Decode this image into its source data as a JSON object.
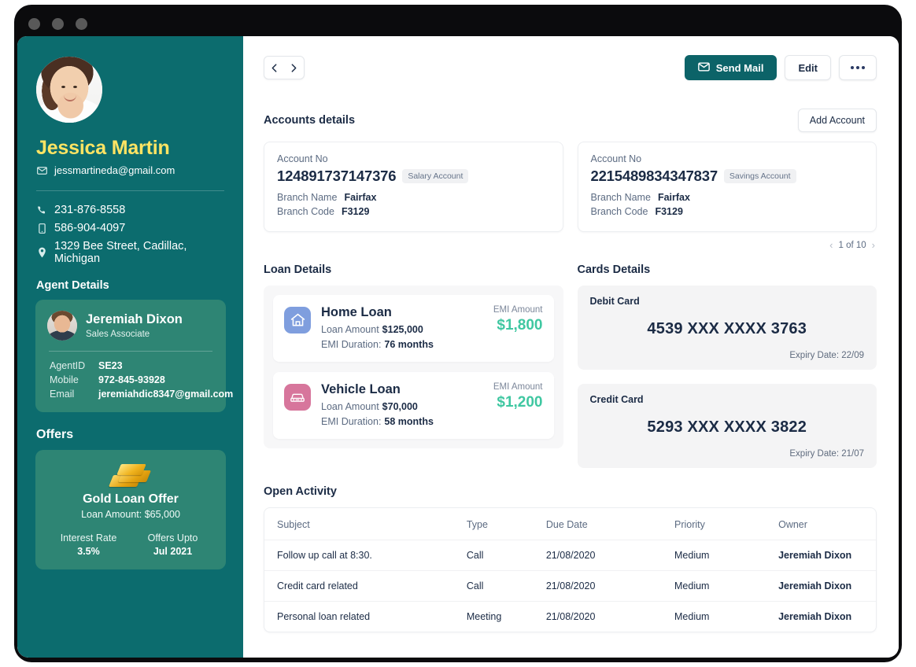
{
  "window": {
    "dots": [
      "close",
      "minimize",
      "maximize"
    ]
  },
  "sidebar": {
    "profile": {
      "name": "Jessica Martin",
      "email": "jessmartineda@gmail.com",
      "email_icon": "envelope-icon",
      "avatar_alt": "Jessica Martin profile photo"
    },
    "contacts": [
      {
        "icon": "phone-icon",
        "value": "231-876-8558"
      },
      {
        "icon": "mobile-icon",
        "value": "586-904-4097"
      },
      {
        "icon": "location-pin-icon",
        "value": "1329  Bee Street, Cadillac, Michigan"
      }
    ],
    "agent_section_title": "Agent Details",
    "agent": {
      "name": "Jeremiah Dixon",
      "role": "Sales Associate",
      "fields": [
        {
          "key": "AgentID",
          "value": "SE23"
        },
        {
          "key": "Mobile",
          "value": "972-845-93928"
        },
        {
          "key": "Email",
          "value": "jeremiahdic8347@gmail.com"
        }
      ]
    },
    "offers_section_title": "Offers",
    "offer": {
      "icon": "gold-bars-icon",
      "title": "Gold Loan Offer",
      "amount": "Loan Amount: $65,000",
      "stats": [
        {
          "label": "Interest Rate",
          "value": "3.5%"
        },
        {
          "label": "Offers Upto",
          "value": "Jul 2021"
        }
      ]
    }
  },
  "toolbar": {
    "prev_icon": "chevron-left-icon",
    "next_icon": "chevron-right-icon",
    "send_mail_label": "Send Mail",
    "send_mail_icon": "envelope-icon",
    "edit_label": "Edit",
    "more_icon": "more-horizontal-icon"
  },
  "accounts": {
    "title": "Accounts details",
    "add_label": "Add Account",
    "items": [
      {
        "label": "Account No",
        "number": "124891737147376",
        "badge": "Salary Account",
        "branch_name_key": "Branch Name",
        "branch_name": "Fairfax",
        "branch_code_key": "Branch Code",
        "branch_code": "F3129"
      },
      {
        "label": "Account No",
        "number": "2215489834347837",
        "badge": "Savings Account",
        "branch_name_key": "Branch Name",
        "branch_name": "Fairfax",
        "branch_code_key": "Branch Code",
        "branch_code": "F3129"
      }
    ],
    "pager": {
      "prev_icon": "chevron-left-icon",
      "text": "1 of 10",
      "next_icon": "chevron-right-icon"
    }
  },
  "loans": {
    "title": "Loan Details",
    "items": [
      {
        "icon": "home-icon",
        "name": "Home Loan",
        "amount_key": "Loan Amount",
        "amount": "$125,000",
        "duration_key": "EMI Duration:",
        "duration": "76 months",
        "emi_label": "EMI Amount",
        "emi_value": "$1,800"
      },
      {
        "icon": "car-icon",
        "name": "Vehicle Loan",
        "amount_key": "Loan Amount",
        "amount": "$70,000",
        "duration_key": "EMI Duration:",
        "duration": "58 months",
        "emi_label": "EMI Amount",
        "emi_value": "$1,200"
      }
    ]
  },
  "cards": {
    "title": "Cards Details",
    "items": [
      {
        "type": "Debit Card",
        "number": "4539 XXX XXXX 3763",
        "expiry": "Expiry Date: 22/09"
      },
      {
        "type": "Credit Card",
        "number": "5293 XXX XXXX 3822",
        "expiry": "Expiry Date: 21/07"
      }
    ]
  },
  "activity": {
    "title": "Open Activity",
    "columns": [
      "Subject",
      "Type",
      "Due Date",
      "Priority",
      "Owner"
    ],
    "rows": [
      {
        "subject": "Follow up call at 8:30.",
        "type": "Call",
        "due": "21/08/2020",
        "priority": "Medium",
        "owner": "Jeremiah Dixon"
      },
      {
        "subject": "Credit card related",
        "type": "Call",
        "due": "21/08/2020",
        "priority": "Medium",
        "owner": "Jeremiah Dixon"
      },
      {
        "subject": "Personal loan related",
        "type": "Meeting",
        "due": "21/08/2020",
        "priority": "Medium",
        "owner": "Jeremiah Dixon"
      }
    ]
  },
  "colors": {
    "sidebar_bg": "#0c6c6e",
    "card_bg": "#2e8574",
    "name_accent": "#ffe463",
    "primary_btn": "#0c6368",
    "emi_green": "#3fc7a1",
    "text_dark": "#1b2b45",
    "home_icon": "#7f9ede",
    "vehicle_icon": "#d7769c"
  }
}
